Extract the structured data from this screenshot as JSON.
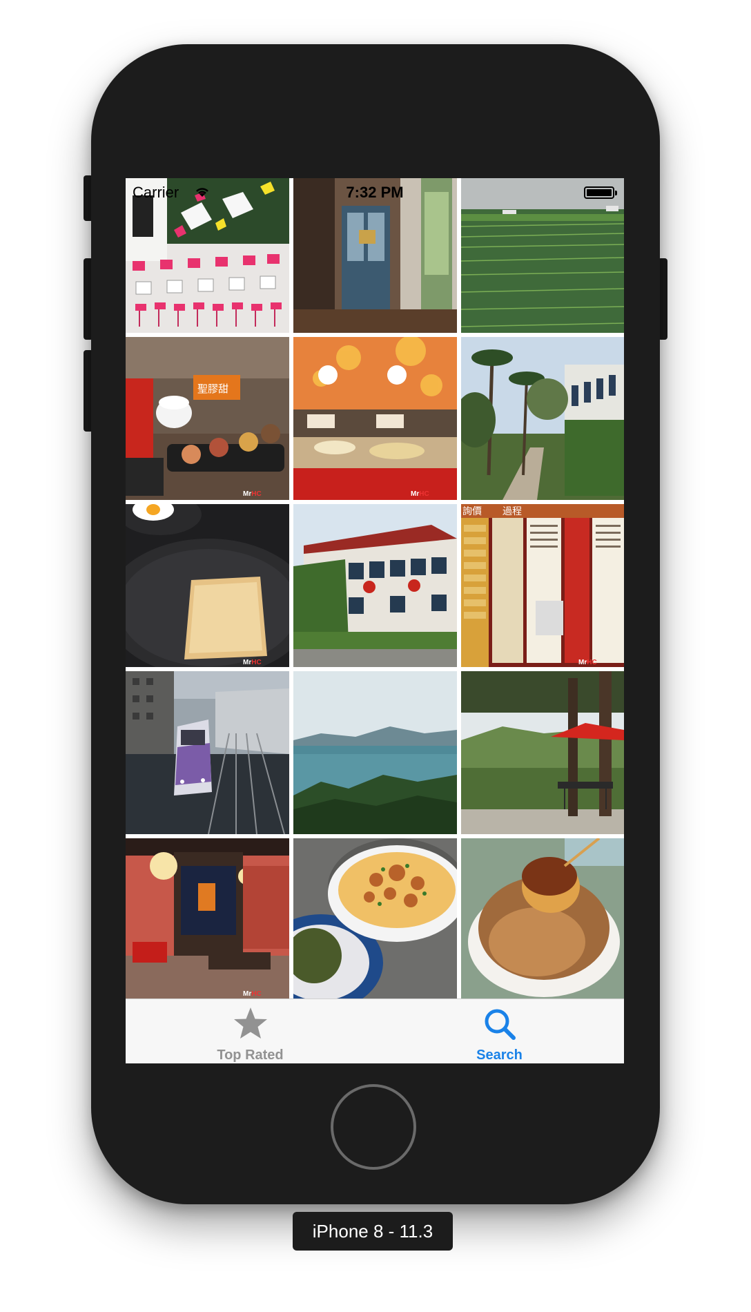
{
  "status_bar": {
    "carrier": "Carrier",
    "time": "7:32 PM",
    "wifi_icon": "wifi-icon",
    "battery_icon": "battery-icon"
  },
  "photos": [
    {
      "id": "p1",
      "subject": "pink tables exhibit"
    },
    {
      "id": "p2",
      "subject": "wooden doorway"
    },
    {
      "id": "p3",
      "subject": "rice paddy"
    },
    {
      "id": "p4",
      "subject": "desserts on table"
    },
    {
      "id": "p5",
      "subject": "red banquet buffet"
    },
    {
      "id": "p6",
      "subject": "palm tree path"
    },
    {
      "id": "p7",
      "subject": "toast in pan"
    },
    {
      "id": "p8",
      "subject": "ivy covered factory"
    },
    {
      "id": "p9",
      "subject": "process signboard"
    },
    {
      "id": "p10",
      "subject": "purple metro train"
    },
    {
      "id": "p11",
      "subject": "lake and hills"
    },
    {
      "id": "p12",
      "subject": "red umbrella garden"
    },
    {
      "id": "p13",
      "subject": "lantern lit restaurant"
    },
    {
      "id": "p14",
      "subject": "noodle bowl"
    },
    {
      "id": "p15",
      "subject": "pudding shaved ice"
    }
  ],
  "watermark": {
    "prefix": "Mr",
    "suffix": "HC"
  },
  "tabbar": {
    "tabs": [
      {
        "label": "Top Rated",
        "icon": "star-icon",
        "selected": false
      },
      {
        "label": "Search",
        "icon": "search-icon",
        "selected": true
      }
    ],
    "active_color": "#1a82e8",
    "inactive_color": "#929292"
  },
  "device": {
    "label": "iPhone 8 - 11.3"
  }
}
